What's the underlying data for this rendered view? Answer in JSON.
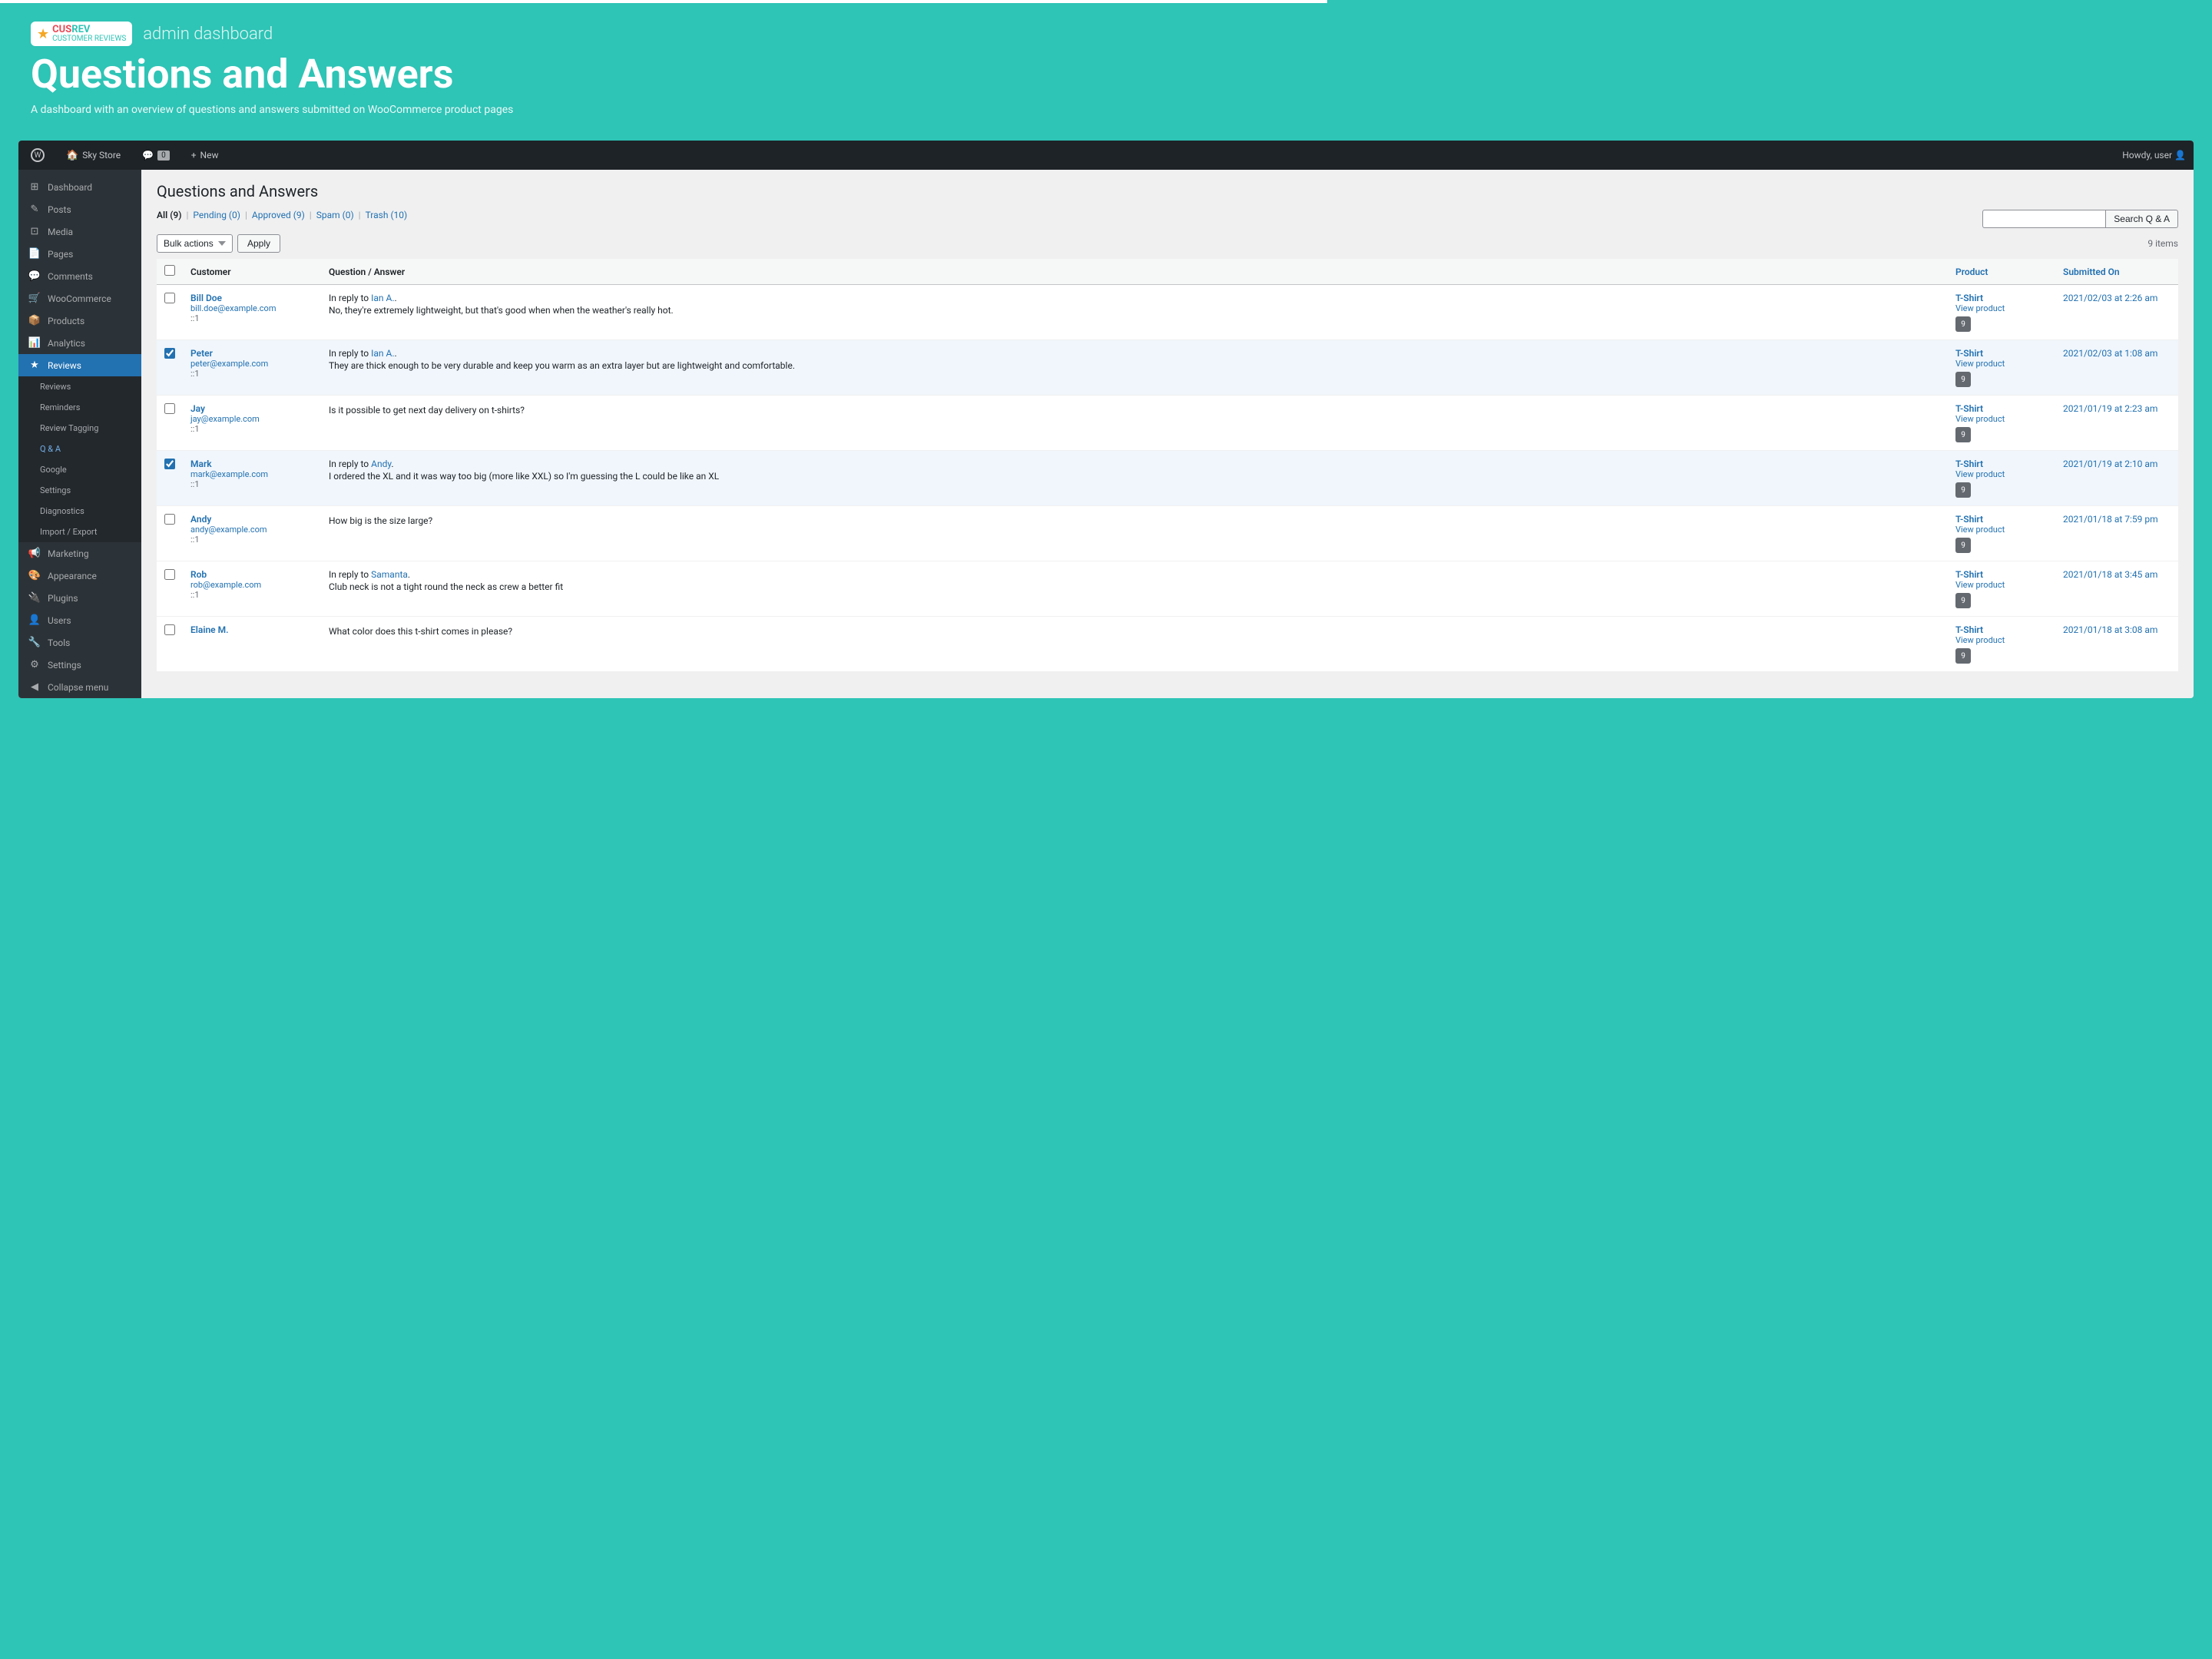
{
  "topBar": {
    "siteName": "Sky Store",
    "commentCount": "0",
    "newLabel": "New",
    "greetingLabel": "Howdy, user"
  },
  "banner": {
    "adminLabel": "admin dashboard",
    "pageTitle": "Questions and Answers",
    "subtitle": "A dashboard with an overview of questions and answers submitted on WooCommerce product pages",
    "brandName": "CUSREV",
    "brandSub": "CUSTOMER REVIEWS"
  },
  "sidebar": {
    "items": [
      {
        "id": "dashboard",
        "label": "Dashboard",
        "icon": "⊞"
      },
      {
        "id": "posts",
        "label": "Posts",
        "icon": "✎"
      },
      {
        "id": "media",
        "label": "Media",
        "icon": "⊡"
      },
      {
        "id": "pages",
        "label": "Pages",
        "icon": "📄"
      },
      {
        "id": "comments",
        "label": "Comments",
        "icon": "💬"
      },
      {
        "id": "woocommerce",
        "label": "WooCommerce",
        "icon": "🛒"
      },
      {
        "id": "products",
        "label": "Products",
        "icon": "📦"
      },
      {
        "id": "analytics",
        "label": "Analytics",
        "icon": "📊"
      },
      {
        "id": "reviews",
        "label": "Reviews",
        "icon": "★",
        "active": true
      }
    ],
    "submenu": [
      {
        "id": "reviews-sub",
        "label": "Reviews",
        "active": false
      },
      {
        "id": "reminders",
        "label": "Reminders",
        "active": false
      },
      {
        "id": "review-tagging",
        "label": "Review Tagging",
        "active": false
      },
      {
        "id": "q-and-a",
        "label": "Q & A",
        "active": true
      },
      {
        "id": "google",
        "label": "Google",
        "active": false
      },
      {
        "id": "settings-sub",
        "label": "Settings",
        "active": false
      },
      {
        "id": "diagnostics",
        "label": "Diagnostics",
        "active": false
      },
      {
        "id": "import-export",
        "label": "Import / Export",
        "active": false
      }
    ],
    "bottomItems": [
      {
        "id": "marketing",
        "label": "Marketing",
        "icon": "📢"
      },
      {
        "id": "appearance",
        "label": "Appearance",
        "icon": "🎨"
      },
      {
        "id": "plugins",
        "label": "Plugins",
        "icon": "🔌"
      },
      {
        "id": "users",
        "label": "Users",
        "icon": "👤"
      },
      {
        "id": "tools",
        "label": "Tools",
        "icon": "🔧"
      },
      {
        "id": "settings",
        "label": "Settings",
        "icon": "⚙"
      },
      {
        "id": "collapse",
        "label": "Collapse menu",
        "icon": "◀"
      }
    ]
  },
  "main": {
    "title": "Questions and Answers",
    "filters": [
      {
        "id": "all",
        "label": "All",
        "count": 9,
        "active": true
      },
      {
        "id": "pending",
        "label": "Pending",
        "count": 0
      },
      {
        "id": "approved",
        "label": "Approved",
        "count": 9
      },
      {
        "id": "spam",
        "label": "Spam",
        "count": 0
      },
      {
        "id": "trash",
        "label": "Trash",
        "count": 10
      }
    ],
    "searchPlaceholder": "",
    "searchButton": "Search Q & A",
    "bulkActions": "Bulk actions",
    "applyButton": "Apply",
    "itemsCount": "9 items",
    "columns": [
      {
        "id": "customer",
        "label": "Customer"
      },
      {
        "id": "qa",
        "label": "Question / Answer"
      },
      {
        "id": "product",
        "label": "Product"
      },
      {
        "id": "submitted",
        "label": "Submitted On"
      }
    ],
    "rows": [
      {
        "id": 1,
        "checked": false,
        "customerName": "Bill Doe",
        "customerEmail": "bill.doe@example.com",
        "customerRating": "::1",
        "replyTo": "Ian A.",
        "questionAnswer": "No, they're extremely lightweight, but that's good when when the weather's really hot.",
        "product": "T-Shirt",
        "productLink": "View product",
        "productBadge": "9",
        "date": "2021/02/03 at 2:26 am"
      },
      {
        "id": 2,
        "checked": true,
        "customerName": "Peter",
        "customerEmail": "peter@example.com",
        "customerRating": "::1",
        "replyTo": "Ian A.",
        "questionAnswer": "They are thick enough to be very durable and keep you warm as an extra layer but are lightweight and comfortable.",
        "product": "T-Shirt",
        "productLink": "View product",
        "productBadge": "9",
        "date": "2021/02/03 at 1:08 am"
      },
      {
        "id": 3,
        "checked": false,
        "customerName": "Jay",
        "customerEmail": "jay@example.com",
        "customerRating": "::1",
        "replyTo": null,
        "questionAnswer": "Is it possible to get next day delivery on t-shirts?",
        "product": "T-Shirt",
        "productLink": "View product",
        "productBadge": "9",
        "date": "2021/01/19 at 2:23 am"
      },
      {
        "id": 4,
        "checked": true,
        "customerName": "Mark",
        "customerEmail": "mark@example.com",
        "customerRating": "::1",
        "replyTo": "Andy",
        "questionAnswer": "I ordered the XL and it was way too big (more like XXL) so I'm guessing the L could be like an XL",
        "product": "T-Shirt",
        "productLink": "View product",
        "productBadge": "9",
        "date": "2021/01/19 at 2:10 am"
      },
      {
        "id": 5,
        "checked": false,
        "customerName": "Andy",
        "customerEmail": "andy@example.com",
        "customerRating": "::1",
        "replyTo": null,
        "questionAnswer": "How big is the size large?",
        "product": "T-Shirt",
        "productLink": "View product",
        "productBadge": "9",
        "date": "2021/01/18 at 7:59 pm"
      },
      {
        "id": 6,
        "checked": false,
        "customerName": "Rob",
        "customerEmail": "rob@example.com",
        "customerRating": "::1",
        "replyTo": "Samanta",
        "questionAnswer": "Club neck is not a tight round the neck as crew a better fit",
        "product": "T-Shirt",
        "productLink": "View product",
        "productBadge": "9",
        "date": "2021/01/18 at 3:45 am"
      },
      {
        "id": 7,
        "checked": false,
        "customerName": "Elaine M.",
        "customerEmail": "",
        "customerRating": "",
        "replyTo": null,
        "questionAnswer": "What color does this t-shirt comes in please?",
        "product": "T-Shirt",
        "productLink": "View product",
        "productBadge": "9",
        "date": "2021/01/18 at 3:08 am"
      }
    ]
  }
}
